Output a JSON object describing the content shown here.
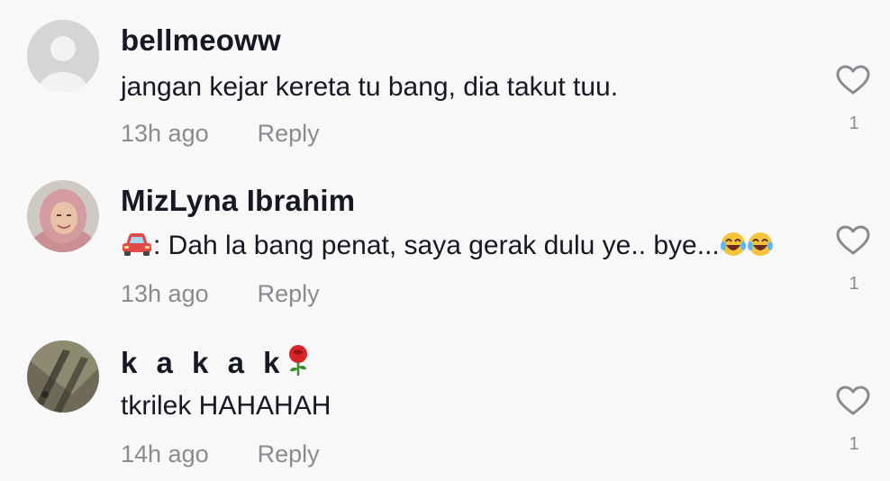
{
  "comments": [
    {
      "username": "bellmeoww",
      "text": "jangan kejar kereta tu bang, dia takut tuu.",
      "time": "13h ago",
      "reply_label": "Reply",
      "likes": "1"
    },
    {
      "username": "MizLyna Ibrahim",
      "text_prefix": ": Dah la bang penat, saya gerak dulu ye.. bye...",
      "time": "13h ago",
      "reply_label": "Reply",
      "likes": "1"
    },
    {
      "username": "k a k a k",
      "text": "tkrilek HAHAHAH",
      "time": "14h ago",
      "reply_label": "Reply",
      "likes": "1"
    }
  ],
  "icons": {
    "like": "heart-outline-icon",
    "car": "car-emoji-icon",
    "laugh": "tears-of-joy-emoji-icon",
    "rose": "rose-emoji-icon"
  },
  "colors": {
    "background": "#f8f8f8",
    "text_primary": "#161823",
    "text_secondary": "#8a8b91"
  }
}
